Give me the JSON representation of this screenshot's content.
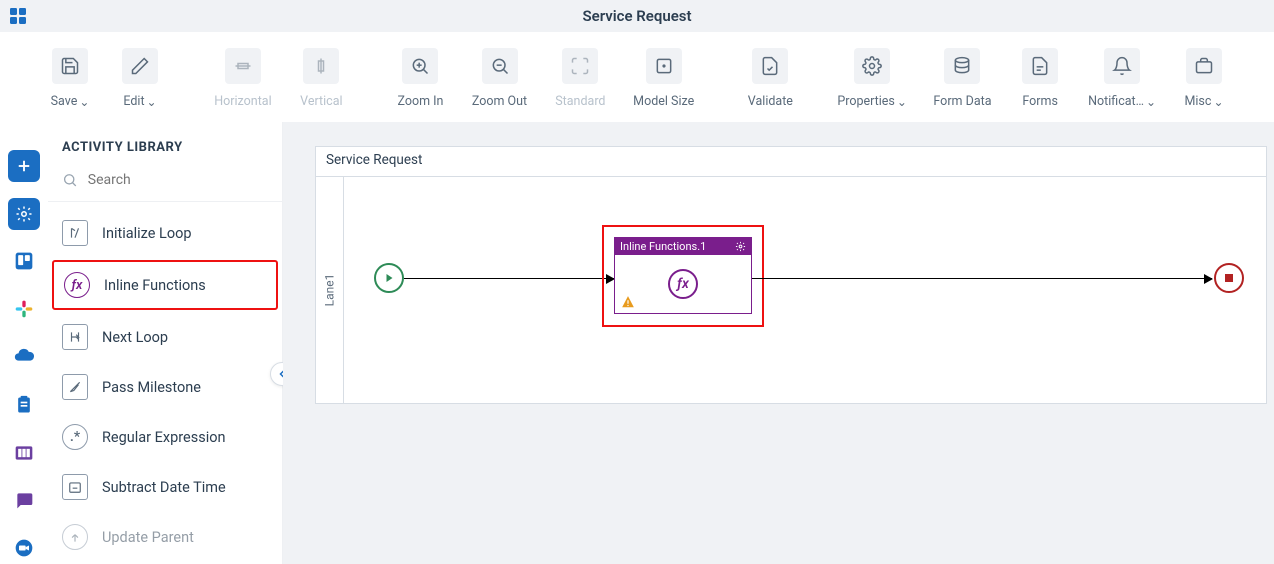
{
  "header": {
    "title": "Service Request"
  },
  "toolbar": {
    "save": "Save",
    "edit": "Edit",
    "horizontal": "Horizontal",
    "vertical": "Vertical",
    "zoom_in": "Zoom In",
    "zoom_out": "Zoom Out",
    "standard": "Standard",
    "model_size": "Model Size",
    "validate": "Validate",
    "properties": "Properties",
    "form_data": "Form Data",
    "forms": "Forms",
    "notifications": "Notificat…",
    "misc": "Misc"
  },
  "library": {
    "title": "ACTIVITY LIBRARY",
    "search_placeholder": "Search",
    "items": [
      "Initialize Loop",
      "Inline Functions",
      "Next Loop",
      "Pass Milestone",
      "Regular Expression",
      "Subtract Date Time",
      "Update Parent"
    ],
    "highlighted_index": 1
  },
  "canvas": {
    "title": "Service Request",
    "lane_label": "Lane1",
    "node": {
      "title": "Inline Functions.1"
    }
  },
  "colors": {
    "accent_primary": "#1b6ec2",
    "node_purple": "#7a1e8c",
    "start_green": "#2e8b57",
    "end_red": "#b22222",
    "highlight_red": "#e11"
  }
}
